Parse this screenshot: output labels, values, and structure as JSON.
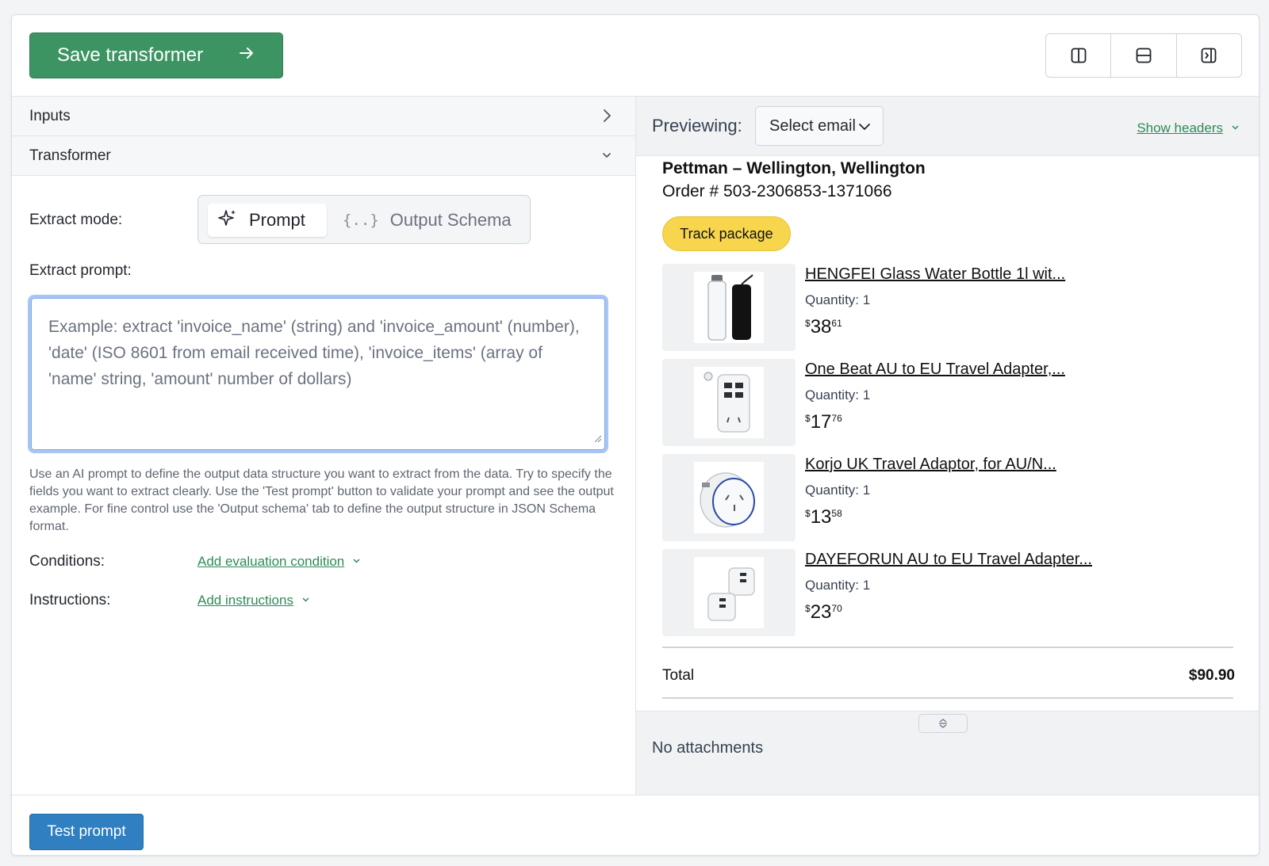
{
  "toolbar": {
    "save_label": "Save transformer",
    "layout_buttons": [
      "split-vertical-icon",
      "split-horizontal-icon",
      "panel-right-icon"
    ]
  },
  "left": {
    "accordion": {
      "inputs_label": "Inputs",
      "transformer_label": "Transformer"
    },
    "extract_mode_label": "Extract mode:",
    "modes": {
      "prompt": "Prompt",
      "schema": "Output Schema",
      "schema_glyph": "{..}",
      "selected": "Prompt"
    },
    "extract_prompt_label": "Extract prompt:",
    "prompt_placeholder": "Example: extract 'invoice_name' (string) and 'invoice_amount' (number), 'date' (ISO 8601 from email received time), 'invoice_items' (array of 'name' string, 'amount' number of dollars)",
    "help_text": "Use an AI prompt to define the output data structure you want to extract from the data. Try to specify the fields you want to extract clearly. Use the 'Test prompt' button to validate your prompt and see the output example. For fine control use the 'Output schema' tab to define the output structure in JSON Schema format.",
    "conditions_label": "Conditions:",
    "add_condition_link": "Add evaluation condition",
    "instructions_label": "Instructions:",
    "add_instructions_link": "Add instructions"
  },
  "preview": {
    "label": "Previewing:",
    "select_value": "Select email",
    "show_headers": "Show headers",
    "email": {
      "sender_line": "Pettman – Wellington, Wellington",
      "order_line": "Order # 503-2306853-1371066",
      "track_button": "Track package",
      "items": [
        {
          "title": "HENGFEI Glass Water Bottle 1l wit...",
          "quantity": "Quantity: 1",
          "currency": "$",
          "price_whole": "38",
          "price_frac": "61"
        },
        {
          "title": "One Beat AU to EU Travel Adapter,...",
          "quantity": "Quantity: 1",
          "currency": "$",
          "price_whole": "17",
          "price_frac": "76"
        },
        {
          "title": "Korjo UK Travel Adaptor, for AU/N...",
          "quantity": "Quantity: 1",
          "currency": "$",
          "price_whole": "13",
          "price_frac": "58"
        },
        {
          "title": "DAYEFORUN AU to EU Travel Adapter...",
          "quantity": "Quantity: 1",
          "currency": "$",
          "price_whole": "23",
          "price_frac": "70"
        }
      ],
      "total_label": "Total",
      "total_value": "$90.90"
    },
    "attachments_text": "No attachments"
  },
  "bottom": {
    "test_label": "Test prompt"
  },
  "colors": {
    "save_button": "#3d9463",
    "test_button": "#2f7fc1",
    "link_green": "#2e8b57",
    "track_button": "#f7d54d",
    "focus_ring": "#a9c6f3"
  }
}
